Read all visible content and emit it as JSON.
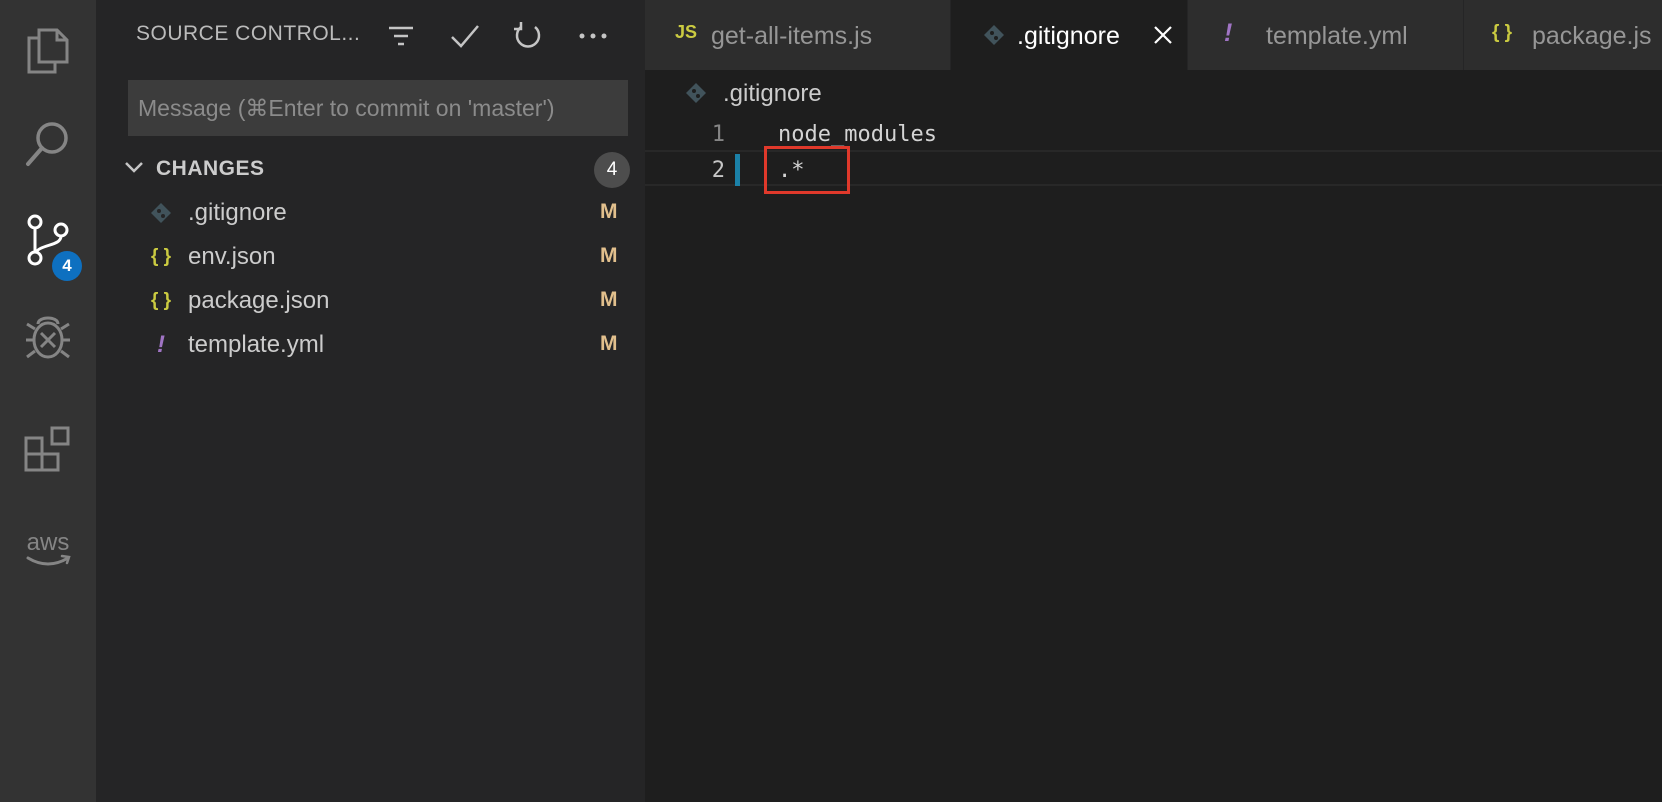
{
  "activity_bar": {
    "items": [
      {
        "name": "explorer",
        "icon": "files-icon"
      },
      {
        "name": "search",
        "icon": "search-icon"
      },
      {
        "name": "source-control",
        "icon": "source-control-icon",
        "badge": "4"
      },
      {
        "name": "debug",
        "icon": "debug-icon"
      },
      {
        "name": "extensions",
        "icon": "extensions-icon"
      },
      {
        "name": "aws",
        "icon": "aws-icon",
        "label": "aws"
      }
    ]
  },
  "sidebar": {
    "title": "SOURCE CONTROL...",
    "actions": [
      "filter-icon",
      "commit-check-icon",
      "refresh-icon",
      "more-icon"
    ],
    "commit_placeholder": "Message (⌘Enter to commit on 'master')",
    "changes": {
      "label": "CHANGES",
      "count": "4",
      "files": [
        {
          "name": ".gitignore",
          "icon": "git-icon",
          "icon_text": "◆",
          "icon_color": "#41535b",
          "status": "M"
        },
        {
          "name": "env.json",
          "icon": "json-icon",
          "icon_text": "{ }",
          "icon_color": "#cbcb41",
          "status": "M"
        },
        {
          "name": "package.json",
          "icon": "json-icon",
          "icon_text": "{ }",
          "icon_color": "#cbcb41",
          "status": "M"
        },
        {
          "name": "template.yml",
          "icon": "yaml-icon",
          "icon_text": "!",
          "icon_color": "#a074c4",
          "status": "M"
        }
      ]
    }
  },
  "tabs": [
    {
      "label": "get-all-items.js",
      "icon_text": "JS",
      "icon_color": "#cbcb41",
      "active": false
    },
    {
      "label": ".gitignore",
      "icon_text": "◆",
      "icon_color": "#41535b",
      "active": true
    },
    {
      "label": "template.yml",
      "icon_text": "!",
      "icon_color": "#a074c4",
      "active": false
    },
    {
      "label": "package.js",
      "icon_text": "{ }",
      "icon_color": "#cbcb41",
      "active": false
    }
  ],
  "breadcrumb": {
    "label": ".gitignore"
  },
  "editor": {
    "lines": [
      {
        "number": "1",
        "text": "node_modules",
        "modified": false
      },
      {
        "number": "2",
        "text": ".*",
        "modified": true
      }
    ]
  },
  "colors": {
    "accent": "#0e70c0",
    "modified_status": "#e2c08d",
    "highlight": "#e0392b"
  }
}
